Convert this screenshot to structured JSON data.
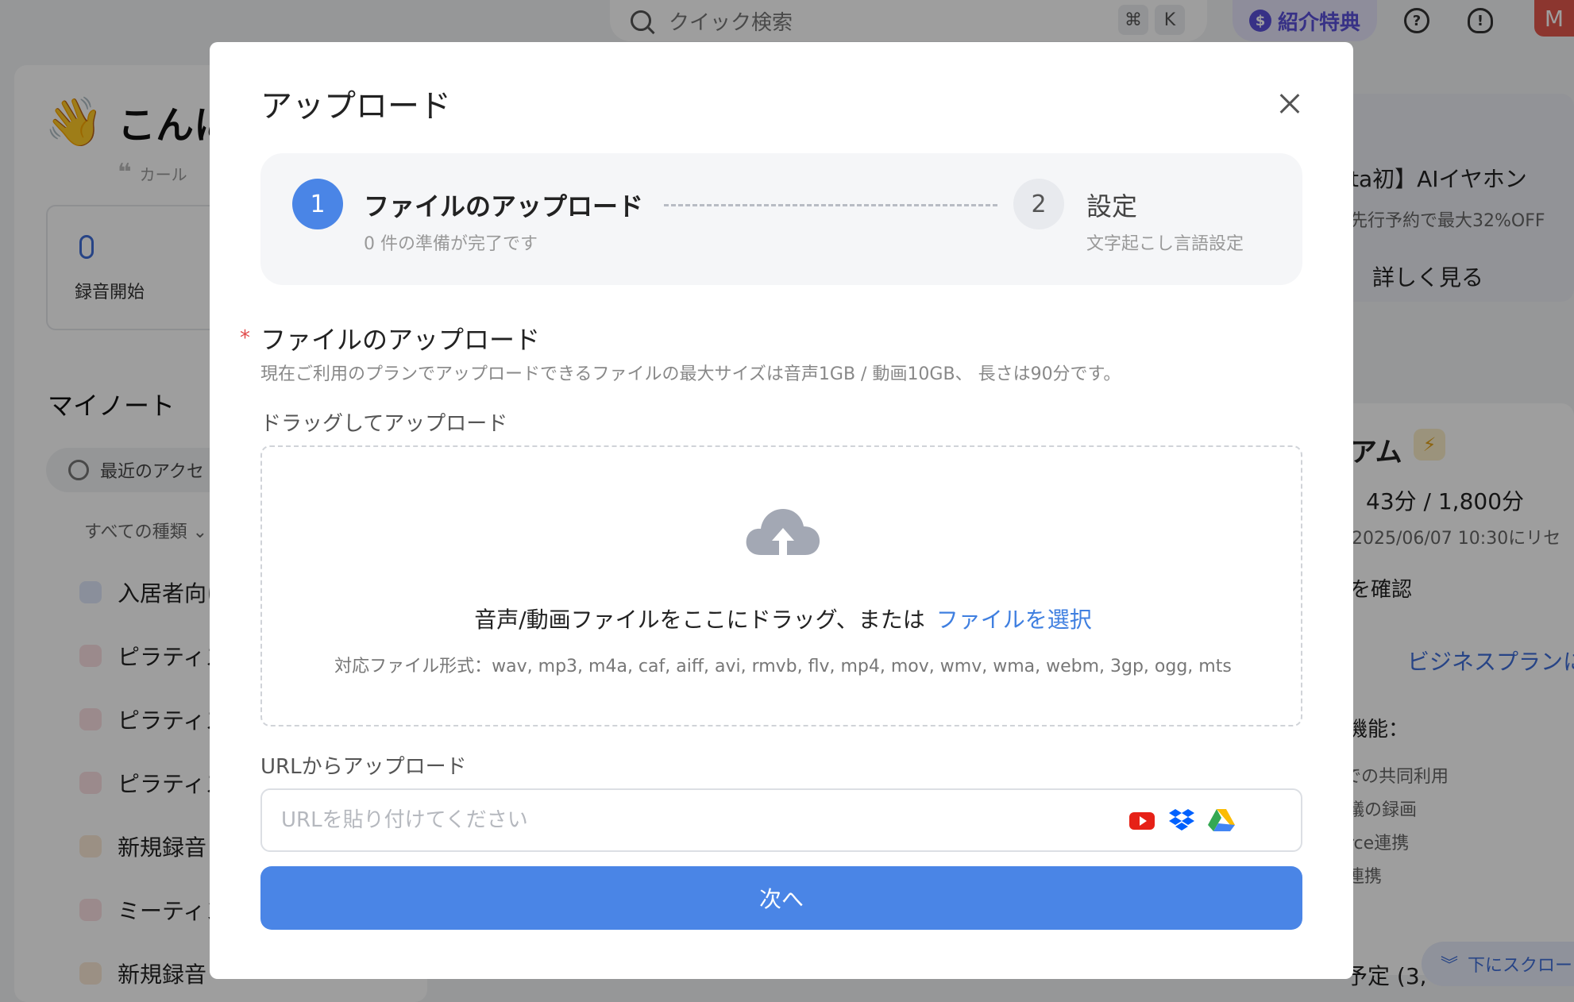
{
  "topbar": {
    "search_placeholder": "クイック検索",
    "shortcut_cmd": "⌘",
    "shortcut_key": "K",
    "referral_label": "紹介特典",
    "avatar_initial": "M"
  },
  "sidebar": {
    "greeting_emoji": "👋",
    "greeting_partial": "こんに",
    "quote_partial": "カール",
    "record_label": "録音開始",
    "notes_title": "マイノート",
    "recent_filter": "最近のアクセ",
    "type_filter": "すべての種類 ⌄",
    "notes": [
      {
        "title": "入居者向け"
      },
      {
        "title": "ピラティス"
      },
      {
        "title": "ピラティス"
      },
      {
        "title": "ピラティス"
      },
      {
        "title": "新規録音"
      },
      {
        "title": "ミーティン"
      },
      {
        "title": "新規録音"
      }
    ]
  },
  "right": {
    "promo_title": "ta初】AIイヤホン",
    "promo_sub": "先行予約で最大32%OFF",
    "promo_link": "詳しく見る",
    "plan_title": "アム",
    "usage": "：43分 / 1,800分",
    "reset": "2025/06/07 10:30にリセ",
    "check": "を確認",
    "business_link": "ビジネスプランに",
    "features_title": "機能：",
    "features": [
      "での共同利用",
      "議の録画",
      "rce連携",
      "連携"
    ],
    "scheduled": "予定 (3,",
    "scroll_hint": "下にスクロー"
  },
  "modal": {
    "title": "アップロード",
    "steps": [
      {
        "num": "1",
        "title": "ファイルのアップロード",
        "sub": "0 件の準備が完了です"
      },
      {
        "num": "2",
        "title": "設定",
        "sub": "文字起こし言語設定"
      }
    ],
    "section_title": "ファイルのアップロード",
    "section_desc": "現在ご利用のプランでアップロードできるファイルの最大サイズは音声1GB / 動画10GB、 長さは90分です。",
    "drag_label": "ドラッグしてアップロード",
    "drop_text": "音声/動画ファイルをここにドラッグ、または",
    "drop_link": "ファイルを選択",
    "formats": "対応ファイル形式：wav, mp3, m4a, caf, aiff, avi, rmvb, flv, mp4, mov, wmv, wma, webm, 3gp, ogg, mts",
    "url_label": "URLからアップロード",
    "url_placeholder": "URLを貼り付けてください",
    "url_value": "",
    "next_label": "次へ"
  },
  "colors": {
    "primary": "#4a85e6",
    "link": "#3f7fe0",
    "required": "#e14b4b",
    "referral": "#5a4fd9"
  }
}
